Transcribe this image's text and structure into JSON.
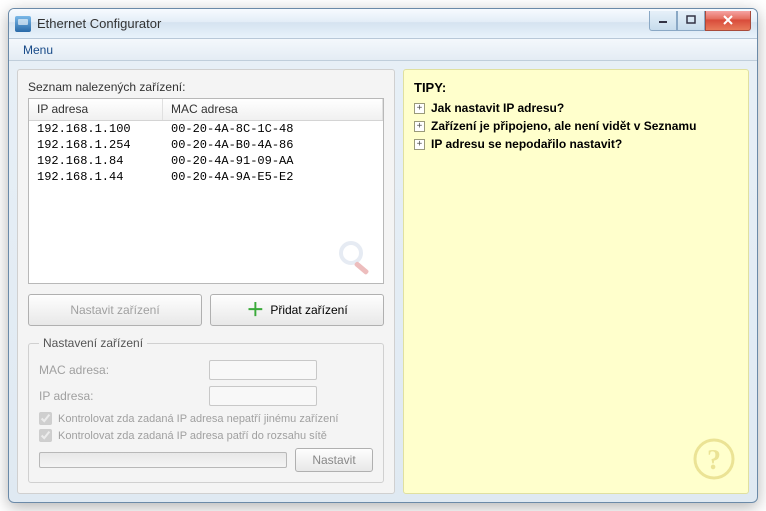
{
  "window": {
    "title": "Ethernet Configurator"
  },
  "menubar": {
    "menu": "Menu"
  },
  "left": {
    "listLabel": "Seznam nalezených zařízení:",
    "columns": {
      "ip": "IP adresa",
      "mac": "MAC adresa"
    },
    "rows": [
      {
        "ip": "192.168.1.100",
        "mac": "00-20-4A-8C-1C-48"
      },
      {
        "ip": "192.168.1.254",
        "mac": "00-20-4A-B0-4A-86"
      },
      {
        "ip": "192.168.1.84",
        "mac": "00-20-4A-91-09-AA"
      },
      {
        "ip": "192.168.1.44",
        "mac": "00-20-4A-9A-E5-E2"
      }
    ],
    "configureBtn": "Nastavit zařízení",
    "addBtn": "Přidat zařízení",
    "settingsLegend": "Nastavení zařízení",
    "macLabel": "MAC adresa:",
    "ipLabel": "IP adresa:",
    "check1": "Kontrolovat zda zadaná IP adresa nepatří jinému zařízení",
    "check2": "Kontrolovat zda zadaná IP adresa patří do rozsahu sítě",
    "applyBtn": "Nastavit"
  },
  "right": {
    "tipsTitle": "TIPY:",
    "tips": [
      "Jak nastavit IP adresu?",
      "Zařízení je připojeno, ale není vidět v Seznamu",
      "IP adresu se nepodařilo nastavit?"
    ]
  }
}
